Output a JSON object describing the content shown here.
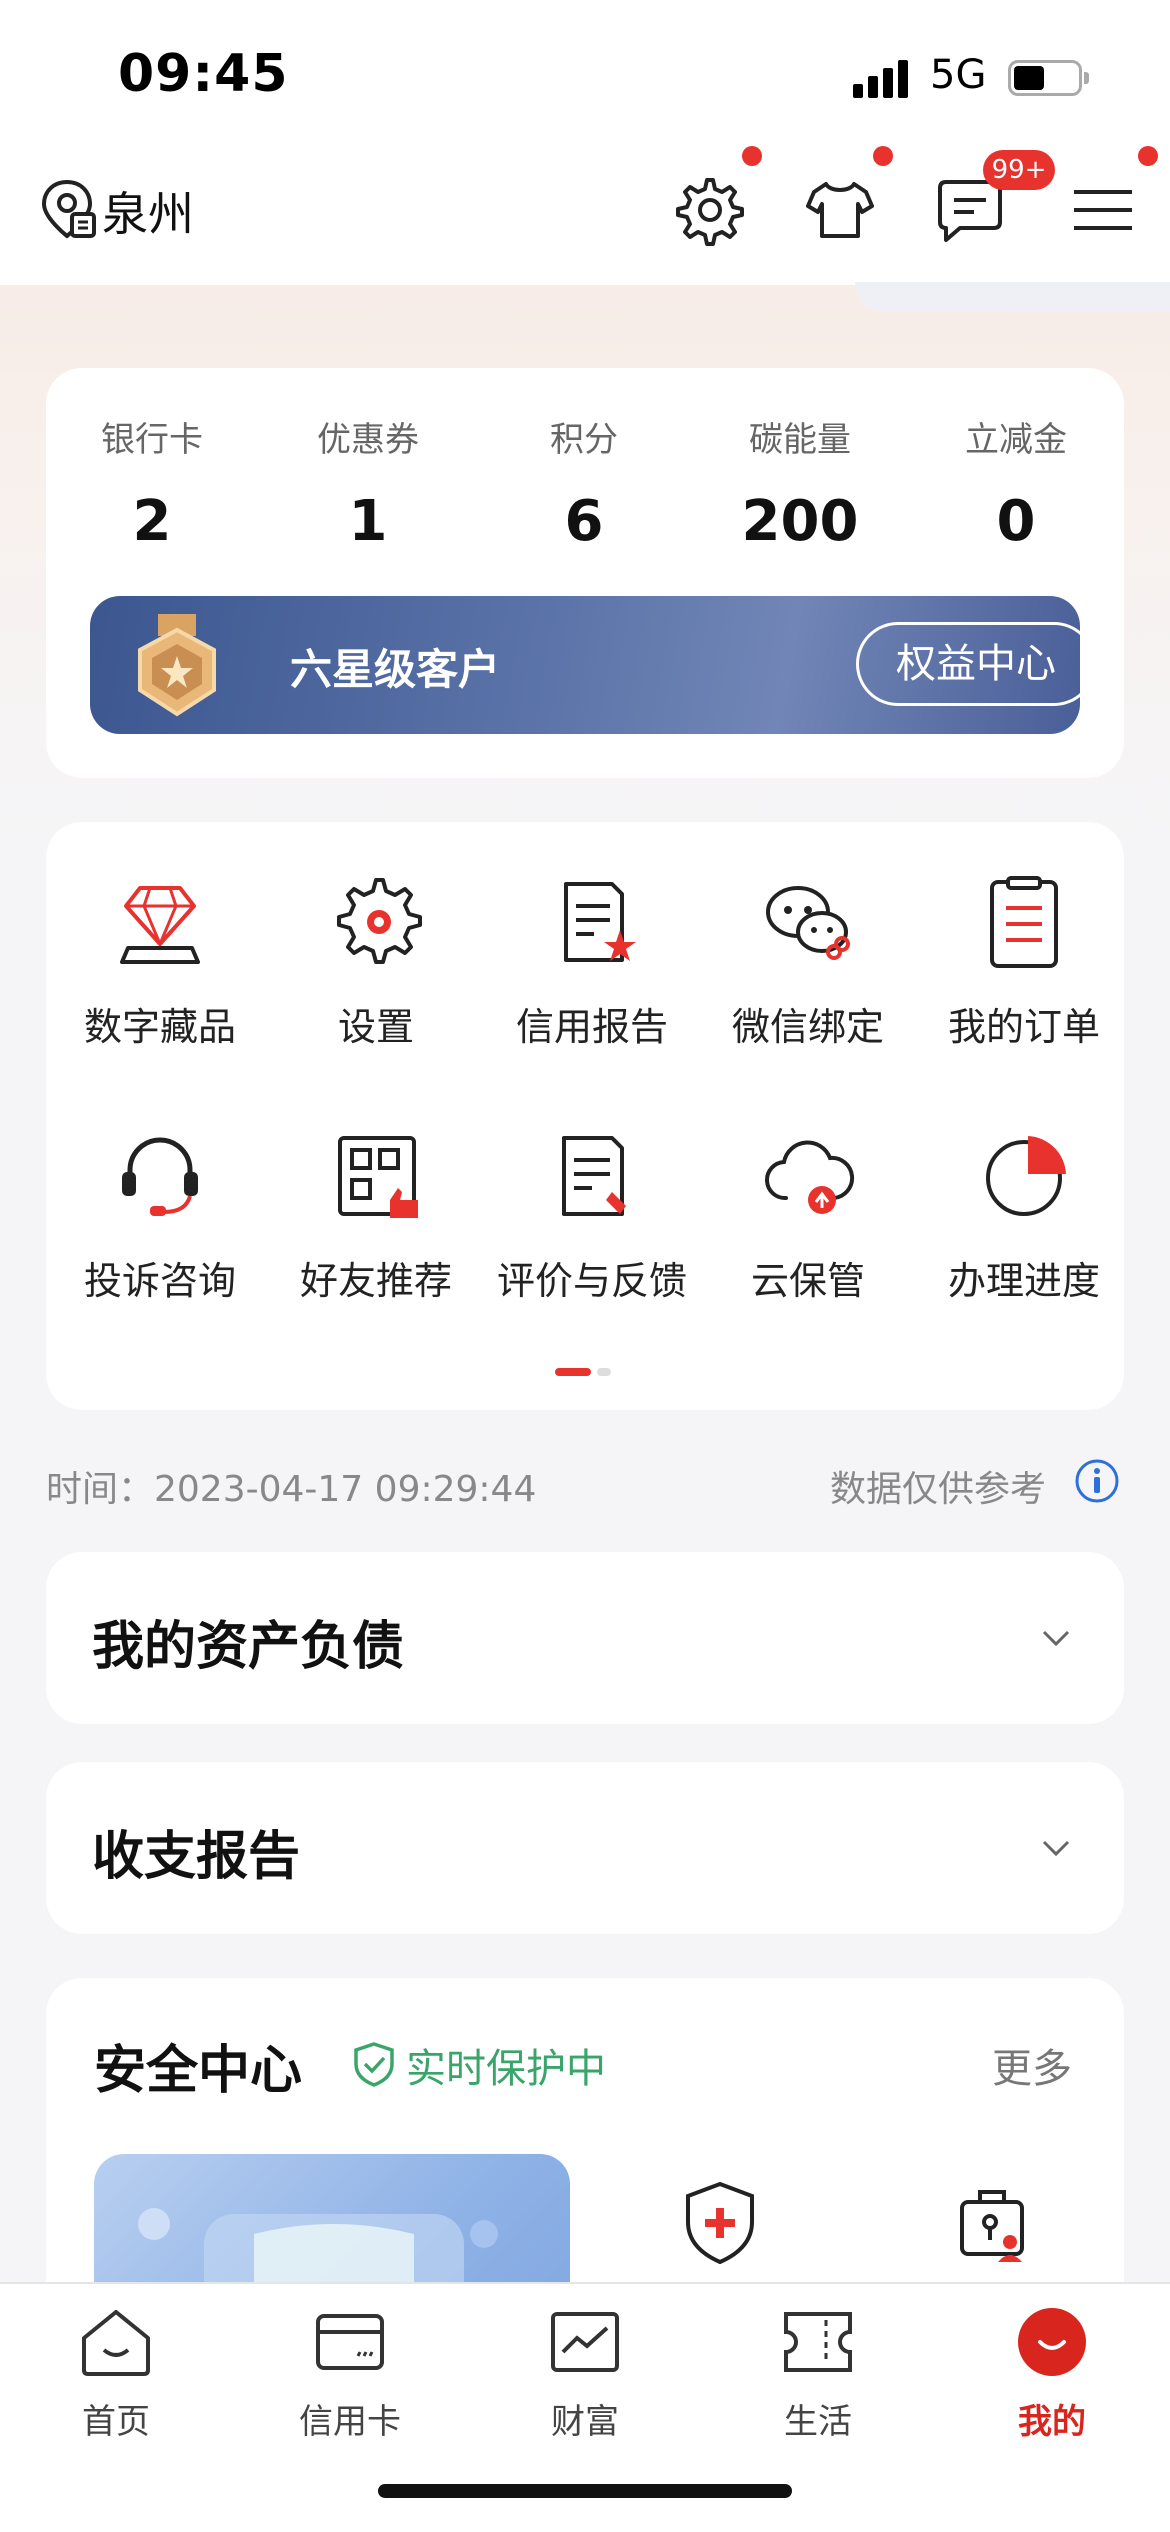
{
  "status_bar": {
    "time": "09:45",
    "network": "5G"
  },
  "header": {
    "city": "泉州",
    "message_badge": "99+"
  },
  "stats": [
    {
      "label": "银行卡",
      "value": "2"
    },
    {
      "label": "优惠券",
      "value": "1"
    },
    {
      "label": "积分",
      "value": "6"
    },
    {
      "label": "碳能量",
      "value": "200"
    },
    {
      "label": "立减金",
      "value": "0"
    }
  ],
  "vip": {
    "level": "六星级客户",
    "button": "权益中心"
  },
  "grid": [
    {
      "label": "数字藏品",
      "icon": "diamond-icon"
    },
    {
      "label": "设置",
      "icon": "gear-icon"
    },
    {
      "label": "信用报告",
      "icon": "report-star-icon"
    },
    {
      "label": "微信绑定",
      "icon": "wechat-link-icon"
    },
    {
      "label": "我的订单",
      "icon": "clipboard-icon"
    },
    {
      "label": "投诉咨询",
      "icon": "headset-icon"
    },
    {
      "label": "好友推荐",
      "icon": "qr-thumb-icon"
    },
    {
      "label": "评价与反馈",
      "icon": "feedback-icon"
    },
    {
      "label": "云保管",
      "icon": "cloud-upload-icon"
    },
    {
      "label": "办理进度",
      "icon": "progress-pie-icon"
    }
  ],
  "data_time": "时间：2023-04-17 09:29:44",
  "data_note": "数据仅供参考",
  "sections": {
    "assets": "我的资产负债",
    "report": "收支报告"
  },
  "security": {
    "title": "安全中心",
    "status": "实时保护中",
    "more": "更多"
  },
  "tabs": [
    {
      "label": "首页",
      "icon": "home-icon"
    },
    {
      "label": "信用卡",
      "icon": "credit-card-icon"
    },
    {
      "label": "财富",
      "icon": "wealth-chart-icon"
    },
    {
      "label": "生活",
      "icon": "ticket-icon"
    },
    {
      "label": "我的",
      "icon": "profile-icon",
      "active": true
    }
  ],
  "colors": {
    "accent": "#e8322e",
    "vip_blue": "#4a5f98",
    "safe_green": "#3aa56a"
  }
}
